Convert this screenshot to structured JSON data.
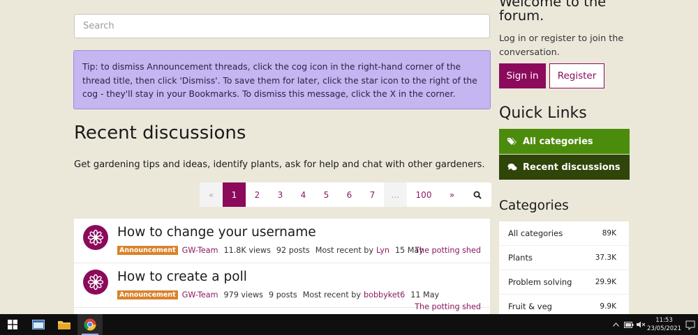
{
  "search": {
    "placeholder": "Search"
  },
  "tip": {
    "text": "Tip: to dismiss Announcement threads, click the cog icon in the right-hand corner of the thread title, then click 'Dismiss'. To save them for later, click the star icon to the right of the cog - they'll stay in your Bookmarks. To dismiss this message, click the X in the corner."
  },
  "main": {
    "heading": "Recent discussions",
    "description": "Get gardening tips and ideas, identify plants, ask for help and chat with other gardeners."
  },
  "pagination": {
    "prev": "«",
    "pages": [
      "1",
      "2",
      "3",
      "4",
      "5",
      "6",
      "7"
    ],
    "ellipsis": "...",
    "last": "100",
    "next": "»",
    "active": "1"
  },
  "discussions": [
    {
      "title": "How to change your username",
      "badge": "Announcement",
      "author": "GW-Team",
      "views": "11.8K views",
      "posts": "92 posts",
      "recent_label": "Most recent by",
      "recent_user": "Lyn",
      "date": "15 May",
      "category": "The potting shed"
    },
    {
      "title": "How to create a poll",
      "badge": "Announcement",
      "author": "GW-Team",
      "views": "979 views",
      "posts": "9 posts",
      "recent_label": "Most recent by",
      "recent_user": "bobbyket6",
      "date": "11 May",
      "category": "The potting shed"
    }
  ],
  "sidebar": {
    "welcome_line1": "Welcome to the",
    "welcome_line2": "forum.",
    "login_text": "Log in or register to join the conversation.",
    "signin": "Sign in",
    "register": "Register",
    "quick_links_heading": "Quick Links",
    "quick_links": [
      {
        "label": "All categories",
        "icon": "tags-icon",
        "color": "#4c8c0d"
      },
      {
        "label": "Recent discussions",
        "icon": "comments-icon",
        "color": "#2f4509"
      }
    ],
    "categories_heading": "Categories",
    "categories": [
      {
        "name": "All categories",
        "count": "89K"
      },
      {
        "name": "Plants",
        "count": "37.3K"
      },
      {
        "name": "Problem solving",
        "count": "29.9K"
      },
      {
        "name": "Fruit & veg",
        "count": "9.9K"
      }
    ]
  },
  "taskbar": {
    "time": "11:53",
    "date": "23/05/2021",
    "apps": [
      "windows-start",
      "file-explorer-window",
      "file-explorer-folder",
      "chrome"
    ]
  },
  "colors": {
    "brand": "#8b0a5b",
    "tip_bg": "#c5b5f1",
    "page_bg": "#ebe8da",
    "badge": "#d9822b"
  }
}
